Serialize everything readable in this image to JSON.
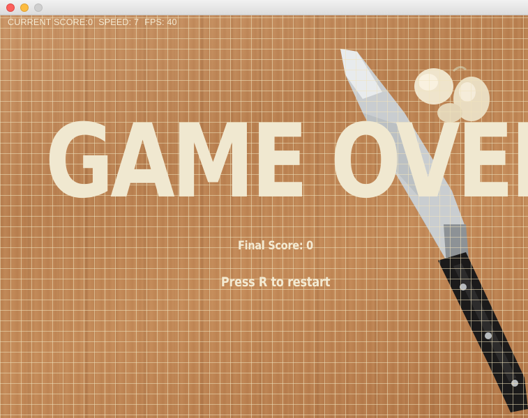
{
  "hud": {
    "score_text": "CURRENT SCORE:0",
    "speed_text": "SPEED: 7",
    "fps_text": "FPS: 40"
  },
  "overlay": {
    "title": "GAME OVER",
    "final_score": "Final Score: 0",
    "restart_hint": "Press R to restart"
  },
  "colors": {
    "overlay_text": "#f0e8d0",
    "grid_line": "#f0e4be",
    "board_wood": "#c08a5a"
  },
  "icons": {
    "background_props": [
      "chef-knife",
      "garlic-cloves"
    ]
  }
}
